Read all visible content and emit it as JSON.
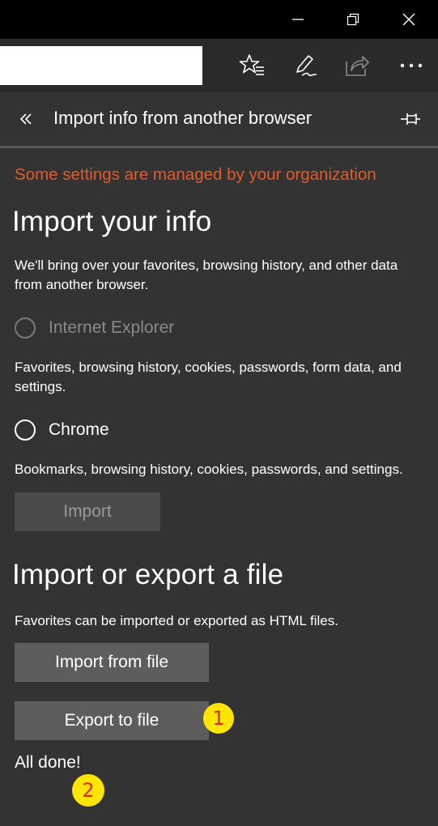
{
  "window": {
    "controls": [
      {
        "name": "minimize-icon"
      },
      {
        "name": "restore-icon"
      },
      {
        "name": "close-icon"
      }
    ]
  },
  "toolbar": {
    "address_value": "",
    "buttons": [
      {
        "name": "favorites-star-icon"
      },
      {
        "name": "web-note-pen-icon"
      },
      {
        "name": "share-icon"
      },
      {
        "name": "more-ellipsis-icon"
      }
    ]
  },
  "panel": {
    "title": "Import info from another browser",
    "managed_notice": "Some settings are managed by your organization",
    "colors": {
      "notice": "#e35a2b",
      "panel_bg": "#333333",
      "button_bg": "#5d5d5d",
      "badge_bg": "#ffe600",
      "badge_text": "#e8222f"
    },
    "import_info": {
      "heading": "Import your info",
      "description": "We'll bring over your favorites, browsing history, and other data from another browser.",
      "options": [
        {
          "label": "Internet Explorer",
          "description": "Favorites, browsing history, cookies, passwords, form data, and settings.",
          "enabled": false,
          "selected": false
        },
        {
          "label": "Chrome",
          "description": "Bookmarks, browsing history, cookies, passwords, and settings.",
          "enabled": true,
          "selected": false
        }
      ],
      "import_button": "Import"
    },
    "file_section": {
      "heading": "Import or export a file",
      "description": "Favorites can be imported or exported as HTML files.",
      "import_button": "Import from file",
      "export_button": "Export to file",
      "status": "All done!"
    },
    "badges": [
      "1",
      "2"
    ]
  }
}
